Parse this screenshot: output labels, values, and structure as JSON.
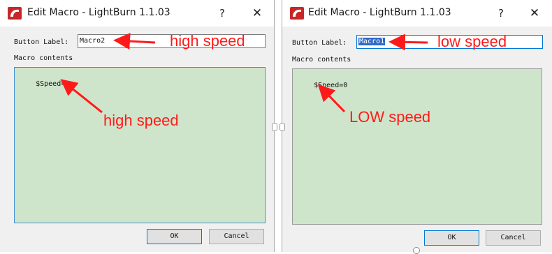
{
  "dialogs": [
    {
      "title": "Edit Macro - LightBurn 1.1.03",
      "help_glyph": "?",
      "close_glyph": "✕",
      "button_label_caption": "Button Label:",
      "button_label_value": "Macro2",
      "macro_contents_caption": "Macro contents",
      "macro_contents_value": "$Speed=1",
      "ok_label": "OK",
      "cancel_label": "Cancel",
      "annotations": {
        "label_note": "high speed",
        "contents_note": "high speed"
      }
    },
    {
      "title": "Edit Macro - LightBurn 1.1.03",
      "help_glyph": "?",
      "close_glyph": "✕",
      "button_label_caption": "Button Label:",
      "button_label_value": "Macro1",
      "macro_contents_caption": "Macro contents",
      "macro_contents_value": "$Speed=0",
      "ok_label": "OK",
      "cancel_label": "Cancel",
      "annotations": {
        "label_note": "low speed",
        "contents_note": "LOW speed"
      }
    }
  ],
  "colors": {
    "annotation_red": "#ff1a1a",
    "macro_box_green": "#cfe5cb",
    "focus_blue": "#0078d7",
    "selection_blue": "#3169c6"
  },
  "icons": {
    "app": "lightburn-icon",
    "help": "help-icon",
    "close": "close-icon"
  }
}
